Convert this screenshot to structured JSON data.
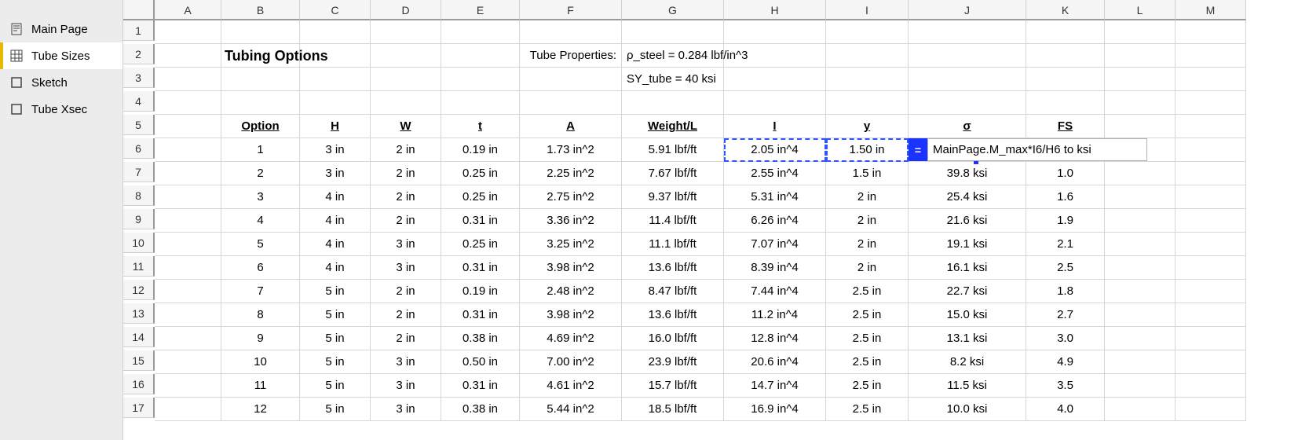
{
  "sidebar": {
    "items": [
      {
        "label": "Main Page",
        "icon": "doc"
      },
      {
        "label": "Tube Sizes",
        "icon": "grid",
        "active": true
      },
      {
        "label": "Sketch",
        "icon": "rect"
      },
      {
        "label": "Tube Xsec",
        "icon": "rect"
      }
    ]
  },
  "columns": [
    "",
    "A",
    "B",
    "C",
    "D",
    "E",
    "F",
    "G",
    "H",
    "I",
    "J",
    "K",
    "L",
    "M"
  ],
  "rows": [
    "1",
    "2",
    "3",
    "4",
    "5",
    "6",
    "7",
    "8",
    "9",
    "10",
    "11",
    "12",
    "13",
    "14",
    "15",
    "16",
    "17"
  ],
  "title_cell": "Tubing Options",
  "props_label": "Tube Properties:",
  "rho_text": "ρ_steel = 0.284 lbf/in^3",
  "sy_text": "SY_tube = 40 ksi",
  "headers": {
    "option": "Option",
    "H": "H",
    "W": "W",
    "t": "t",
    "A": "A",
    "weightL": "Weight/L",
    "I": "I",
    "y": "y",
    "sigma": "σ",
    "FS": "FS"
  },
  "formula": {
    "eq": "=",
    "text": "MainPage.M_max*I6/H6 to ksi"
  },
  "table": [
    {
      "opt": "1",
      "H": "3 in",
      "W": "2 in",
      "t": "0.19 in",
      "A": "1.73 in^2",
      "WL": "5.91 lbf/ft",
      "I": "2.05 in^4",
      "y": "1.50 in",
      "sig": "",
      "FS": ""
    },
    {
      "opt": "2",
      "H": "3 in",
      "W": "2 in",
      "t": "0.25 in",
      "A": "2.25 in^2",
      "WL": "7.67 lbf/ft",
      "I": "2.55 in^4",
      "y": "1.5 in",
      "sig": "39.8 ksi",
      "FS": "1.0"
    },
    {
      "opt": "3",
      "H": "4 in",
      "W": "2 in",
      "t": "0.25 in",
      "A": "2.75 in^2",
      "WL": "9.37 lbf/ft",
      "I": "5.31 in^4",
      "y": "2 in",
      "sig": "25.4 ksi",
      "FS": "1.6"
    },
    {
      "opt": "4",
      "H": "4 in",
      "W": "2 in",
      "t": "0.31 in",
      "A": "3.36 in^2",
      "WL": "11.4 lbf/ft",
      "I": "6.26 in^4",
      "y": "2 in",
      "sig": "21.6 ksi",
      "FS": "1.9"
    },
    {
      "opt": "5",
      "H": "4 in",
      "W": "3 in",
      "t": "0.25 in",
      "A": "3.25 in^2",
      "WL": "11.1 lbf/ft",
      "I": "7.07 in^4",
      "y": "2 in",
      "sig": "19.1 ksi",
      "FS": "2.1"
    },
    {
      "opt": "6",
      "H": "4 in",
      "W": "3 in",
      "t": "0.31 in",
      "A": "3.98 in^2",
      "WL": "13.6 lbf/ft",
      "I": "8.39 in^4",
      "y": "2 in",
      "sig": "16.1 ksi",
      "FS": "2.5"
    },
    {
      "opt": "7",
      "H": "5 in",
      "W": "2 in",
      "t": "0.19 in",
      "A": "2.48 in^2",
      "WL": "8.47 lbf/ft",
      "I": "7.44 in^4",
      "y": "2.5 in",
      "sig": "22.7 ksi",
      "FS": "1.8"
    },
    {
      "opt": "8",
      "H": "5 in",
      "W": "2 in",
      "t": "0.31 in",
      "A": "3.98 in^2",
      "WL": "13.6 lbf/ft",
      "I": "11.2 in^4",
      "y": "2.5 in",
      "sig": "15.0 ksi",
      "FS": "2.7"
    },
    {
      "opt": "9",
      "H": "5 in",
      "W": "2 in",
      "t": "0.38 in",
      "A": "4.69 in^2",
      "WL": "16.0 lbf/ft",
      "I": "12.8 in^4",
      "y": "2.5 in",
      "sig": "13.1 ksi",
      "FS": "3.0"
    },
    {
      "opt": "10",
      "H": "5 in",
      "W": "3 in",
      "t": "0.50 in",
      "A": "7.00 in^2",
      "WL": "23.9 lbf/ft",
      "I": "20.6 in^4",
      "y": "2.5 in",
      "sig": "8.2 ksi",
      "FS": "4.9"
    },
    {
      "opt": "11",
      "H": "5 in",
      "W": "3 in",
      "t": "0.31 in",
      "A": "4.61 in^2",
      "WL": "15.7 lbf/ft",
      "I": "14.7 in^4",
      "y": "2.5 in",
      "sig": "11.5 ksi",
      "FS": "3.5"
    },
    {
      "opt": "12",
      "H": "5 in",
      "W": "3 in",
      "t": "0.38 in",
      "A": "5.44 in^2",
      "WL": "18.5 lbf/ft",
      "I": "16.9 in^4",
      "y": "2.5 in",
      "sig": "10.0 ksi",
      "FS": "4.0"
    }
  ]
}
